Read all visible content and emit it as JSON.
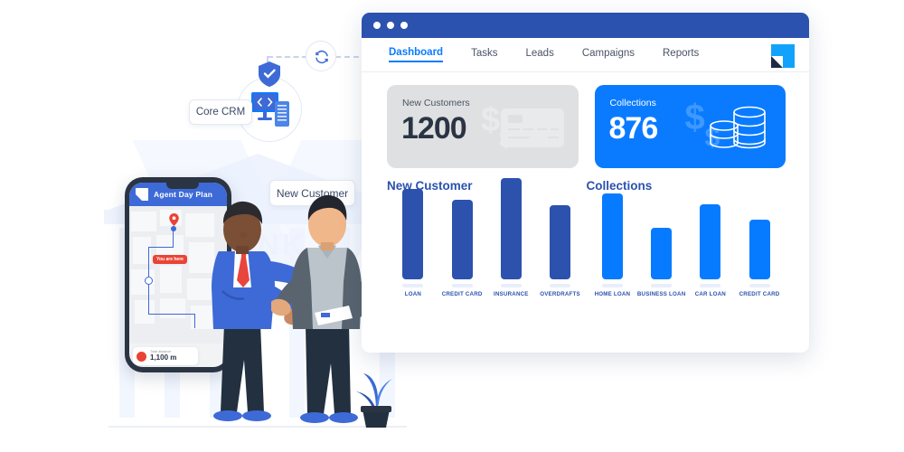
{
  "diagram": {
    "crm_chip": "Core CRM",
    "new_customer_chip": "New Customer",
    "sync_icon": "sync-refresh-icon",
    "shield_icon": "shield-check-icon",
    "server_icon": "code-monitor-server-icon"
  },
  "phone": {
    "app_title": "Agent Day Plan",
    "map_marker_label": "You are here",
    "distance_caption": "Total distance",
    "distance_value": "1,100 m",
    "logo_icon": "app-logo-icon",
    "pin_icon": "map-pin-icon"
  },
  "background": {
    "bank_word": "BANK"
  },
  "window": {
    "titlebar_dots": 3,
    "brand_logo_icon": "brand-logo-icon",
    "tabs": [
      {
        "label": "Dashboard",
        "active": true
      },
      {
        "label": "Tasks",
        "active": false
      },
      {
        "label": "Leads",
        "active": false
      },
      {
        "label": "Campaigns",
        "active": false
      },
      {
        "label": "Reports",
        "active": false
      }
    ],
    "cards": [
      {
        "label": "New Customers",
        "value": "1200",
        "style": "gray",
        "icon": "credit-card-icon"
      },
      {
        "label": "Collections",
        "value": "876",
        "style": "blue",
        "icon": "coin-stack-icon"
      }
    ]
  },
  "colors": {
    "accent_blue": "#0a7bff",
    "deep_blue": "#2c52ae",
    "titlebar_blue": "#2b52ae",
    "card_gray": "#dfe0e2",
    "label_blue": "#2c52ae"
  },
  "chart_data": [
    {
      "type": "bar",
      "title": "New Customer",
      "categories": [
        "LOAN",
        "CREDIT CARD",
        "INSURANCE",
        "OVERDRAFTS"
      ],
      "values": [
        100,
        88,
        112,
        82
      ],
      "xlabel": "",
      "ylabel": "",
      "ylim": [
        0,
        120
      ],
      "grid": false,
      "legend": "none",
      "color": "#2c52ae"
    },
    {
      "type": "bar",
      "title": "Collections",
      "categories": [
        "HOME LOAN",
        "BUSINESS LOAN",
        "CAR LOAN",
        "CREDIT CARD"
      ],
      "values": [
        95,
        57,
        83,
        66
      ],
      "xlabel": "",
      "ylabel": "",
      "ylim": [
        0,
        120
      ],
      "grid": false,
      "legend": "none",
      "color": "#077bff"
    }
  ]
}
